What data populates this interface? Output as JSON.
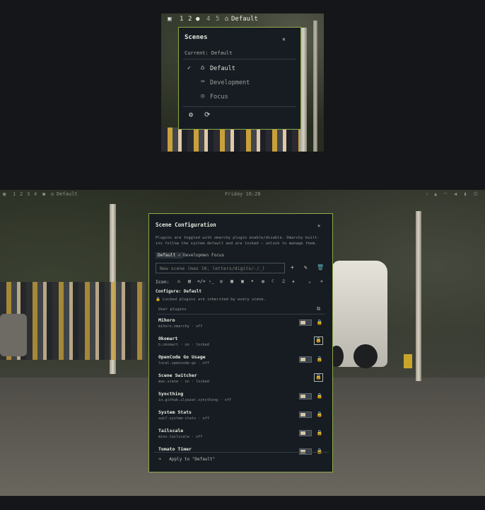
{
  "top_window": {
    "workspaces": [
      "1",
      "2",
      "4",
      "5"
    ],
    "active_scene_label": "Default",
    "scenes_popup": {
      "title": "Scenes",
      "close": "×",
      "current": "Current: Default",
      "items": [
        {
          "label": "Default",
          "icon": "⌂",
          "checked": "✓"
        },
        {
          "label": "Development",
          "icon": "⌨",
          "checked": ""
        },
        {
          "label": "Focus",
          "icon": "◎",
          "checked": ""
        }
      ],
      "footer_icons": [
        "gear-icon",
        "refresh-icon"
      ]
    }
  },
  "bottom_window": {
    "bar": {
      "workspaces": [
        "1",
        "2",
        "3",
        "4"
      ],
      "scene_label": "Default",
      "clock": "Friday 16:28"
    },
    "config": {
      "title": "Scene Configuration",
      "close": "×",
      "description": "Plugins are toggled with omarchy plugin enable/disable. Omarchy built-ins follow the system default and are locked — unlock to manage them.",
      "tabs": [
        {
          "label": "Default ✓",
          "active": true
        },
        {
          "label": "Developmen",
          "active": false
        },
        {
          "label": "Focus",
          "active": false
        }
      ],
      "new_scene_placeholder": "New scene (max 10, letters/digits/-/_)",
      "icon_label": "Icon:",
      "icon_choices": [
        "⌂",
        "▤",
        "</>",
        "›_",
        "◎",
        "▦",
        "▣",
        "➤",
        "◍",
        "☾",
        "♫",
        "★"
      ],
      "configure_label": "Configure: Default",
      "inherit_note": "🔒 Locked plugins are inherited by every scene.",
      "section_label": "User plugins",
      "plugins": [
        {
          "name": "Mihoro",
          "sub": "mihoro.omarchy · off",
          "toggle": true,
          "boxed": false
        },
        {
          "name": "Okomart",
          "sub": "b.okomart · on · locked",
          "toggle": false,
          "boxed": true
        },
        {
          "name": "OpenCode Go Usage",
          "sub": "local.opencode-go · off",
          "toggle": true,
          "boxed": false
        },
        {
          "name": "Scene Switcher",
          "sub": "max.scene · on · locked",
          "toggle": false,
          "boxed": true
        },
        {
          "name": "Syncthing",
          "sub": "io.github.ilyazar.syncthing · off",
          "toggle": true,
          "boxed": false
        },
        {
          "name": "System Stats",
          "sub": "saif.system-stats · off",
          "toggle": true,
          "boxed": false
        },
        {
          "name": "Tailscale",
          "sub": "mino.tailscale · off",
          "toggle": true,
          "boxed": false
        },
        {
          "name": "Tomato Timer",
          "sub": "",
          "toggle": true,
          "boxed": false
        }
      ],
      "apply_label": "Apply to \"Default\""
    }
  },
  "colors": {
    "accent": "#8fa84a",
    "panel": "#161c22",
    "background": "#141619"
  }
}
